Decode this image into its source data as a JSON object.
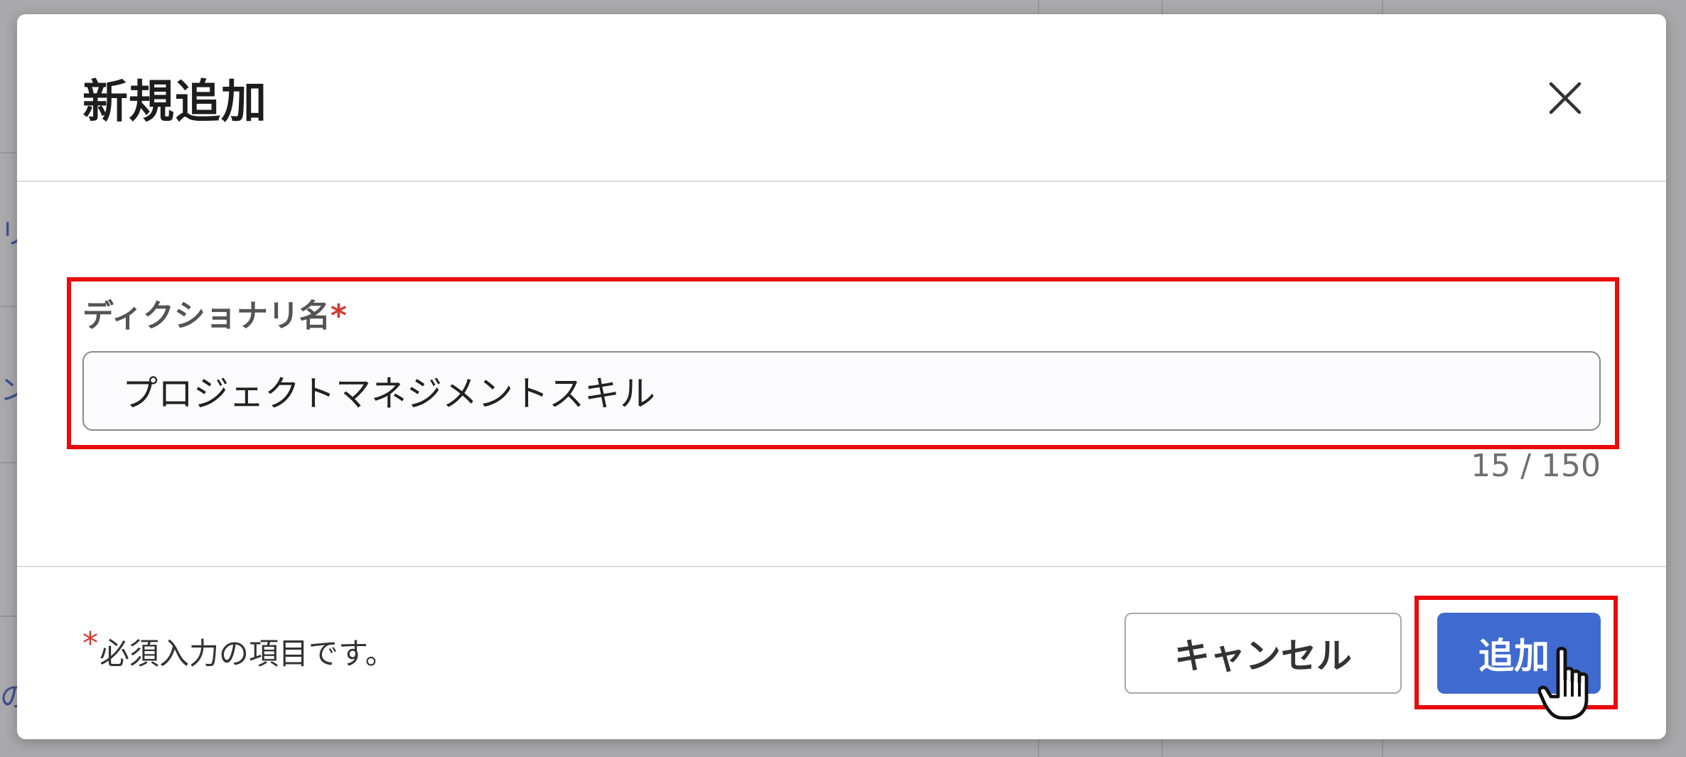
{
  "background": {
    "text_1": "リ",
    "text_2": "ン",
    "text_3": "の項"
  },
  "dialog": {
    "title": "新規追加",
    "close_icon": "close-icon"
  },
  "form": {
    "field_label": "ディクショナリ名",
    "required_mark": "*",
    "input_value": "プロジェクトマネジメントスキル",
    "char_count": "15 / 150"
  },
  "footer": {
    "required_mark": "*",
    "required_note": "必須入力の項目です。",
    "cancel_label": "キャンセル",
    "add_label": "追加"
  },
  "colors": {
    "primary": "#3f6bd0",
    "required": "#d33a2f",
    "highlight": "#ea0a0a"
  }
}
